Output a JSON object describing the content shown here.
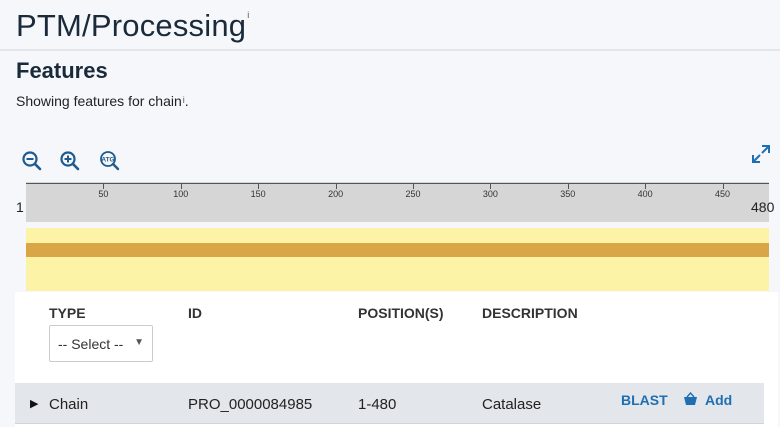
{
  "header": {
    "title": "PTM/Processing",
    "info_marker": "i"
  },
  "features": {
    "title": "Features",
    "description": "Showing features for chain",
    "info_marker": "i",
    "description_end": "."
  },
  "toolbar": {
    "zoom_out_icon": "zoom-out-icon",
    "zoom_in_icon": "zoom-in-icon",
    "sequence_zoom_icon": "atg-zoom-icon",
    "fullscreen_icon": "expand-icon"
  },
  "ruler": {
    "start": "1",
    "end": "480",
    "ticks": [
      "50",
      "100",
      "150",
      "200",
      "250",
      "300",
      "350",
      "400",
      "450"
    ]
  },
  "track": {
    "background_color": "#fdf3a6",
    "feature_color": "#d8a547",
    "range": [
      1,
      480
    ]
  },
  "table": {
    "headers": {
      "type": "TYPE",
      "id": "ID",
      "positions": "POSITION(S)",
      "description": "DESCRIPTION"
    },
    "type_filter": "-- Select --",
    "rows": [
      {
        "type": "Chain",
        "id": "PRO_0000084985",
        "positions": "1-480",
        "description": "Catalase",
        "blast": "BLAST",
        "add": "Add"
      }
    ]
  },
  "colors": {
    "link": "#1f6fb2",
    "title": "#1a2a3a"
  }
}
